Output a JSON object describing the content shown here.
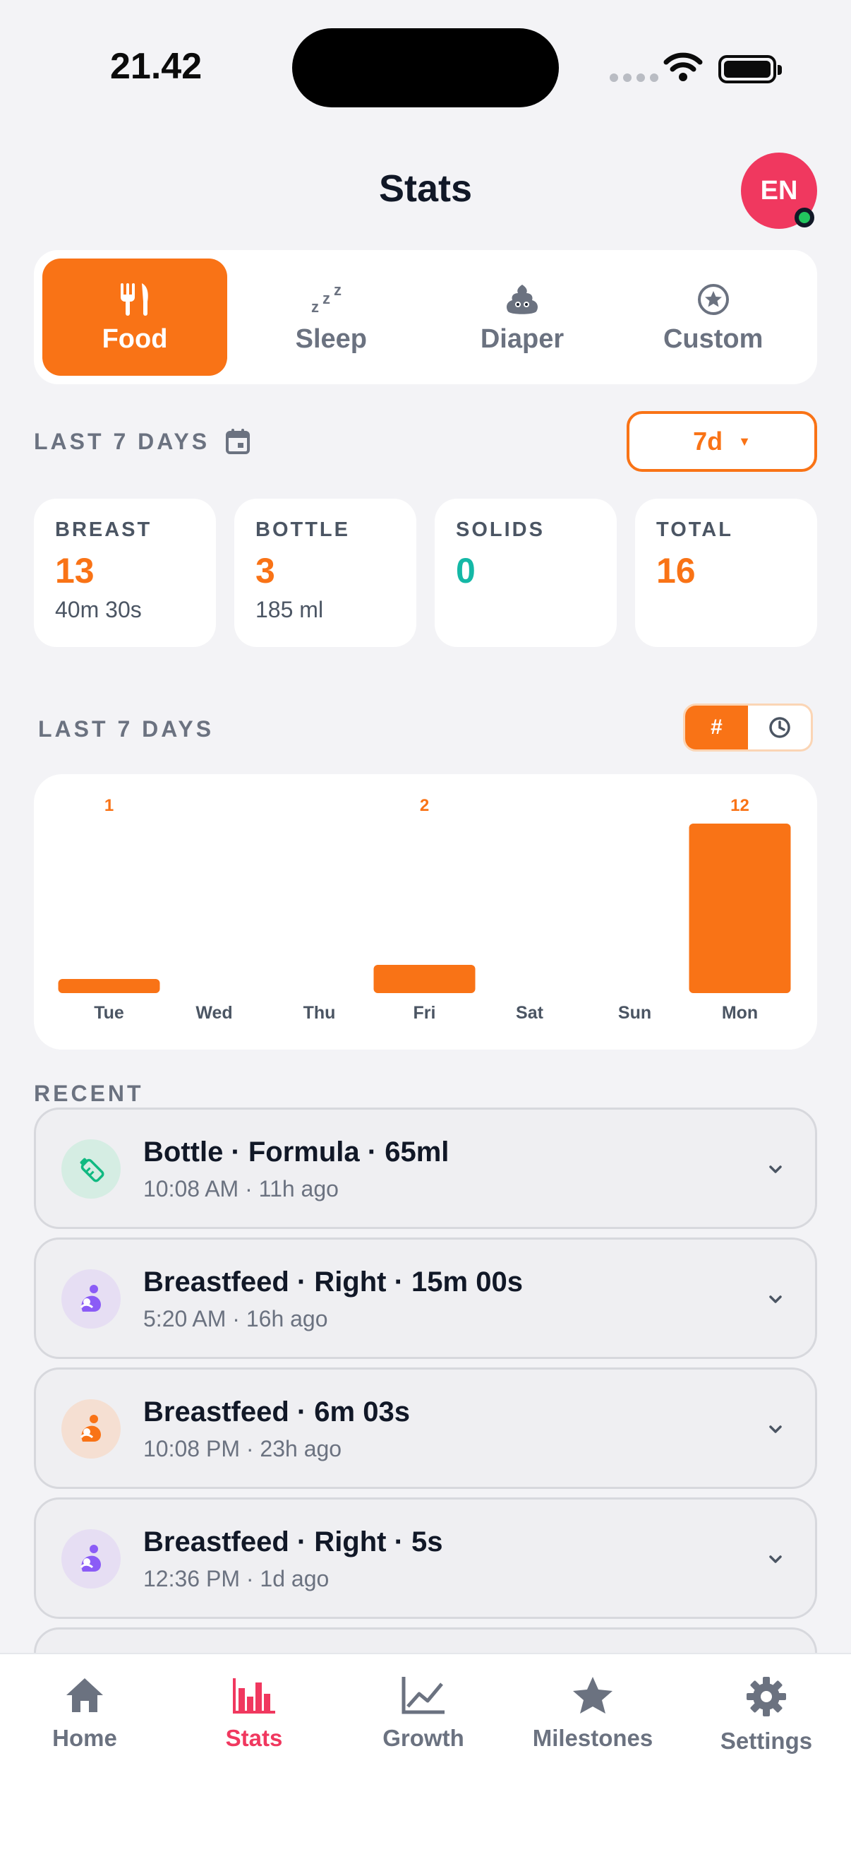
{
  "status_bar": {
    "time": "21.42"
  },
  "header": {
    "title": "Stats",
    "avatar_initials": "EN"
  },
  "tabs": [
    {
      "label": "Food",
      "icon": "fork-knife-icon",
      "active": true
    },
    {
      "label": "Sleep",
      "icon": "zzz-icon",
      "active": false
    },
    {
      "label": "Diaper",
      "icon": "poop-icon",
      "active": false
    },
    {
      "label": "Custom",
      "icon": "star-circle-icon",
      "active": false
    }
  ],
  "range": {
    "label": "LAST 7 DAYS",
    "select_value": "7d"
  },
  "stats": [
    {
      "label": "BREAST",
      "value": "13",
      "sub": "40m 30s"
    },
    {
      "label": "BOTTLE",
      "value": "3",
      "sub": "185 ml"
    },
    {
      "label": "SOLIDS",
      "value": "0",
      "sub": ""
    },
    {
      "label": "TOTAL",
      "value": "16",
      "sub": ""
    }
  ],
  "chart_section": {
    "title": "LAST 7 DAYS",
    "toggle_count": "#",
    "toggle_time_icon": "clock-icon"
  },
  "chart_data": {
    "type": "bar",
    "categories": [
      "Tue",
      "Wed",
      "Thu",
      "Fri",
      "Sat",
      "Sun",
      "Mon"
    ],
    "values": [
      1,
      0,
      0,
      2,
      0,
      0,
      12
    ],
    "data_labels": [
      "1",
      "",
      "",
      "2",
      "",
      "",
      "12"
    ],
    "ylim": [
      0,
      12
    ],
    "bar_color": "#f97316"
  },
  "recent": {
    "title": "RECENT",
    "items": [
      {
        "title": "Bottle · Formula · 65ml",
        "meta": "10:08 AM · 11h ago",
        "icon": "bottle-icon",
        "icon_bg": "#d5ede3",
        "icon_color": "#10b981"
      },
      {
        "title": "Breastfeed · Right · 15m 00s",
        "meta": "5:20 AM · 16h ago",
        "icon": "breastfeed-icon",
        "icon_bg": "#e6def3",
        "icon_color": "#8b5cf6"
      },
      {
        "title": "Breastfeed · 6m 03s",
        "meta": "10:08 PM · 23h ago",
        "icon": "breastfeed-icon",
        "icon_bg": "#f5dfd2",
        "icon_color": "#f97316"
      },
      {
        "title": "Breastfeed · Right · 5s",
        "meta": "12:36 PM · 1d ago",
        "icon": "breastfeed-icon",
        "icon_bg": "#e6def3",
        "icon_color": "#8b5cf6"
      }
    ]
  },
  "nav": [
    {
      "label": "Home",
      "icon": "home-icon",
      "active": false
    },
    {
      "label": "Stats",
      "icon": "bar-chart-icon",
      "active": true
    },
    {
      "label": "Growth",
      "icon": "line-chart-icon",
      "active": false
    },
    {
      "label": "Milestones",
      "icon": "star-icon",
      "active": false
    },
    {
      "label": "Settings",
      "icon": "gear-icon",
      "active": false
    }
  ],
  "colors": {
    "accent": "#f97316",
    "brand_pink": "#f0385f",
    "teal": "#14b8a6"
  }
}
